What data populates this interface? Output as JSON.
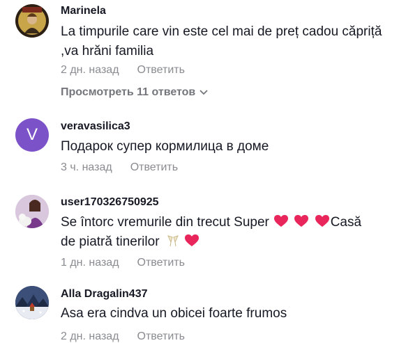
{
  "comments": [
    {
      "username": "Marinela",
      "text": "La timpurile care vin este cel mai de preț cadou căpriță ,va hrăni familia",
      "time": "2 дн. назад",
      "reply_label": "Ответить",
      "view_replies": "Просмотреть 11 ответов"
    },
    {
      "username": "veravasilica3",
      "avatar_letter": "V",
      "text": "Подарок супер кормилица в доме",
      "time": "3 ч. назад",
      "reply_label": "Ответить"
    },
    {
      "username": "user170326750925",
      "text_part1": "Se întorc vremurile din trecut Super",
      "text_part2": "Casă",
      "text_part3": "de piatră tinerilor",
      "time": "1 дн. назад",
      "reply_label": "Ответить"
    },
    {
      "username": "Alla Dragalin437",
      "text": "Asa era cindva un obicei foarte frumos",
      "time": "2 дн. назад",
      "reply_label": "Ответить"
    }
  ],
  "colors": {
    "heart": "#e8265c",
    "avatar_purple": "#7b52c8",
    "meta_gray": "#8a8b91"
  }
}
